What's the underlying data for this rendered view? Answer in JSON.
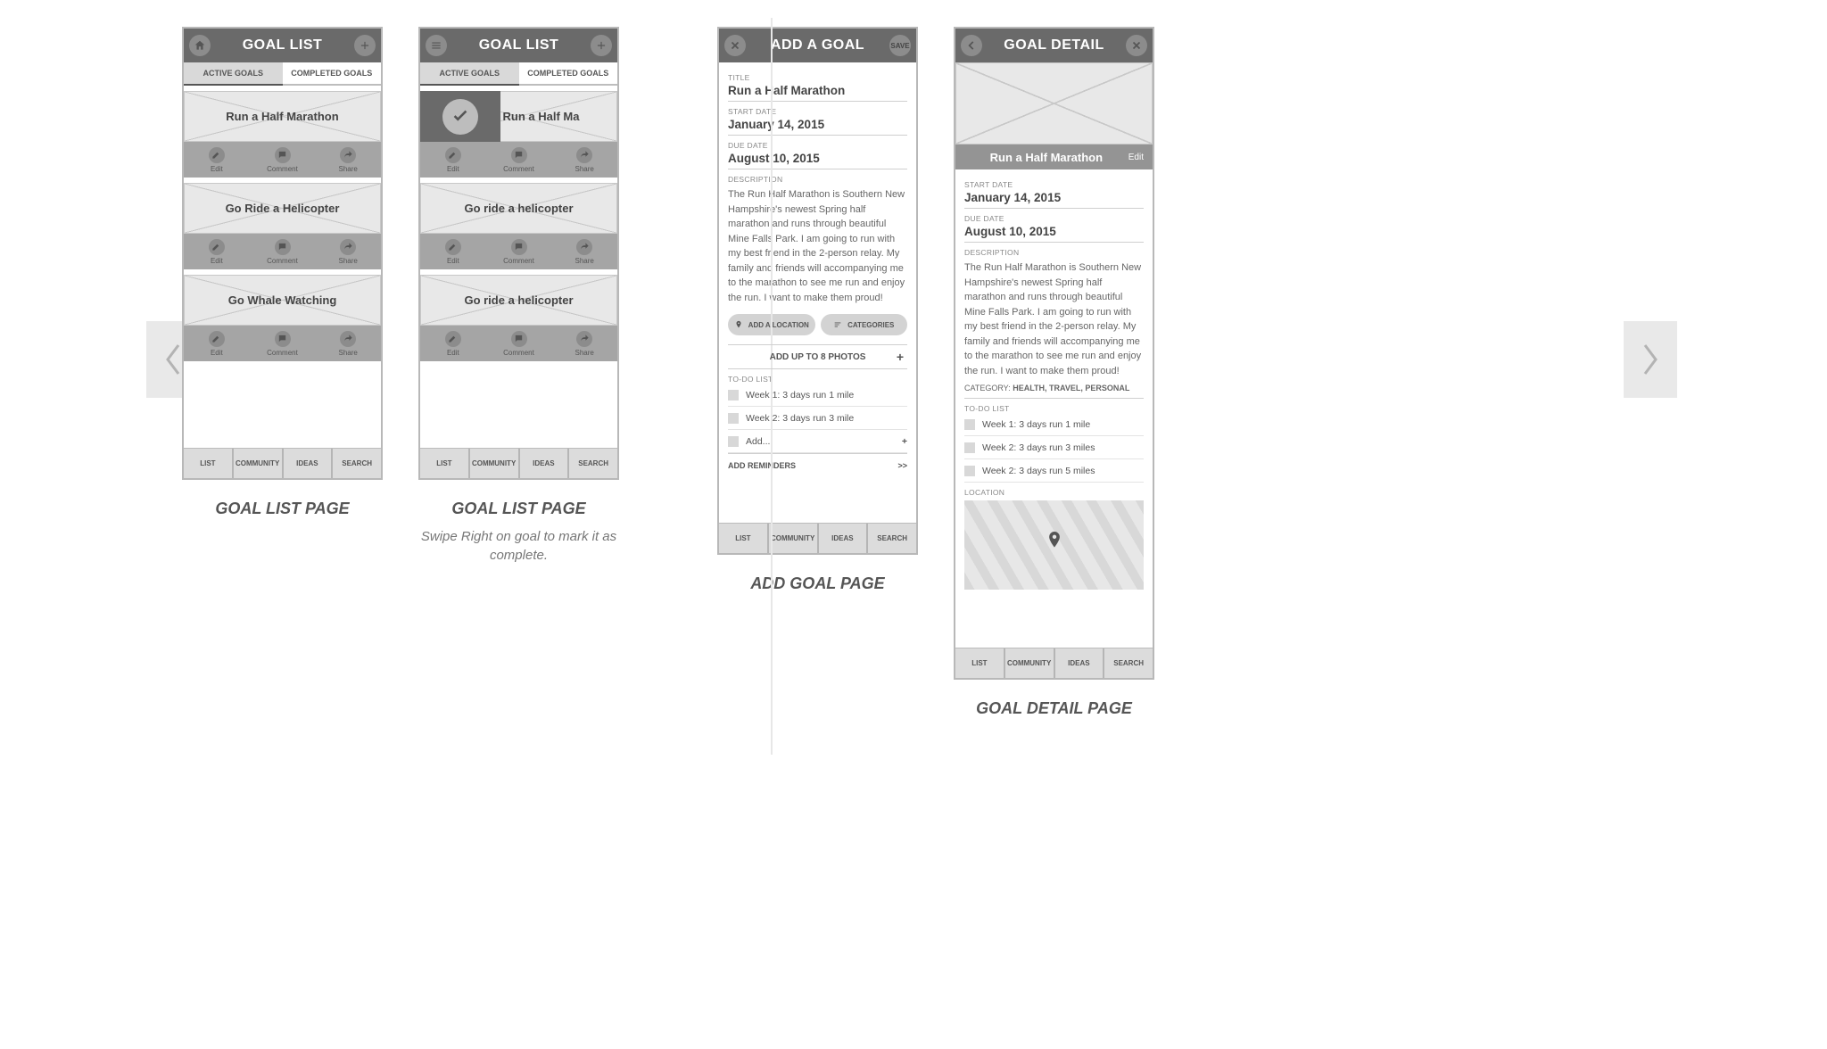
{
  "nav": {
    "list": "LIST",
    "community": "COMMUNITY",
    "ideas": "IDEAS",
    "search": "SEARCH"
  },
  "actions": {
    "edit": "Edit",
    "comment": "Comment",
    "share": "Share"
  },
  "tabs": {
    "active": "ACTIVE GOALS",
    "completed": "COMPLETED GOALS"
  },
  "screen1": {
    "title": "GOAL LIST",
    "caption": "GOAL LIST PAGE",
    "goals": [
      "Run a Half Marathon",
      "Go Ride a Helicopter",
      "Go Whale Watching"
    ]
  },
  "screen2": {
    "title": "GOAL LIST",
    "caption": "GOAL LIST PAGE",
    "subcaption": "Swipe Right on goal to mark it as complete.",
    "goals": [
      "Run a Half Ma",
      "Go ride a helicopter",
      "Go ride a helicopter"
    ]
  },
  "screen3": {
    "title": "ADD A GOAL",
    "save": "SAVE",
    "caption": "ADD GOAL PAGE",
    "labels": {
      "title": "TITLE",
      "start": "START DATE",
      "due": "DUE DATE",
      "desc": "DESCRIPTION",
      "todo": "TO-DO LIST",
      "addloc": "ADD A LOCATION",
      "cats": "CATEGORIES",
      "photos": "ADD UP TO 8 PHOTOS",
      "reminders": "ADD REMINDERS",
      "add": "Add..."
    },
    "values": {
      "title": "Run a Half Marathon",
      "start": "January 14, 2015",
      "due": "August 10, 2015",
      "desc": "The Run Half Marathon is Southern New Hampshire's newest Spring half marathon and runs through beautiful Mine Falls Park. I am going to run with my best friend in the 2-person relay. My family and friends will accompanying me to the marathon to see me run and enjoy the run. I want to make them proud!"
    },
    "todos": [
      "Week 1: 3 days run 1 mile",
      "Week 2: 3 days run 3 mile"
    ]
  },
  "screen4": {
    "title": "GOAL DETAIL",
    "caption": "GOAL DETAIL PAGE",
    "editLabel": "Edit",
    "labels": {
      "start": "START DATE",
      "due": "DUE DATE",
      "desc": "DESCRIPTION",
      "cat": "CATEGORY:",
      "todo": "TO-DO LIST",
      "loc": "LOCATION"
    },
    "values": {
      "goal": "Run a Half Marathon",
      "start": "January 14, 2015",
      "due": "August 10, 2015",
      "cats": "HEALTH, TRAVEL, PERSONAL",
      "desc": "The Run Half Marathon is Southern New Hampshire's newest Spring half marathon and runs through beautiful Mine Falls Park. I am going to run with my best friend in the 2-person relay. My family and friends will accompanying me to the marathon to see me run and enjoy the run. I want to make them proud!"
    },
    "todos": [
      "Week 1: 3 days run 1 mile",
      "Week 2: 3 days run 3 miles",
      "Week 2: 3 days run 5 miles"
    ]
  }
}
